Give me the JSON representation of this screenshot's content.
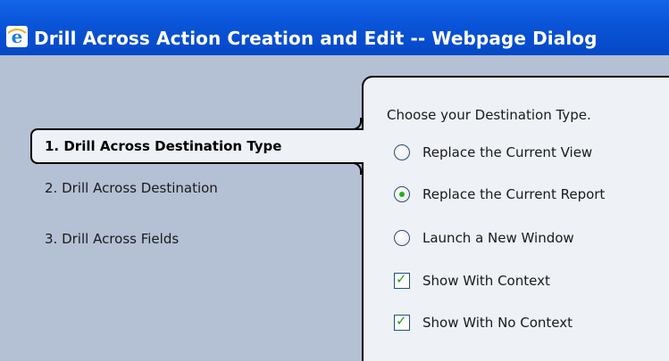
{
  "window": {
    "title": "Drill Across Action Creation and Edit -- Webpage Dialog",
    "icon": "internet-explorer-icon"
  },
  "wizard": {
    "steps": [
      {
        "label": "1. Drill Across Destination Type",
        "active": true
      },
      {
        "label": "2. Drill Across Destination",
        "active": false
      },
      {
        "label": "3. Drill Across Fields",
        "active": false
      }
    ]
  },
  "panel": {
    "instruction": "Choose your Destination Type.",
    "options": [
      {
        "type": "radio",
        "label": "Replace the Current View",
        "checked": false
      },
      {
        "type": "radio",
        "label": "Replace the Current Report",
        "checked": true
      },
      {
        "type": "radio",
        "label": "Launch a New Window",
        "checked": false
      },
      {
        "type": "checkbox",
        "label": "Show With Context",
        "checked": true
      },
      {
        "type": "checkbox",
        "label": "Show With No Context",
        "checked": true
      }
    ]
  },
  "colors": {
    "titlebar": "#0a55d9",
    "sidebar": "#b4c0d4",
    "panel": "#eef1f6",
    "accent_green": "#21a121"
  }
}
